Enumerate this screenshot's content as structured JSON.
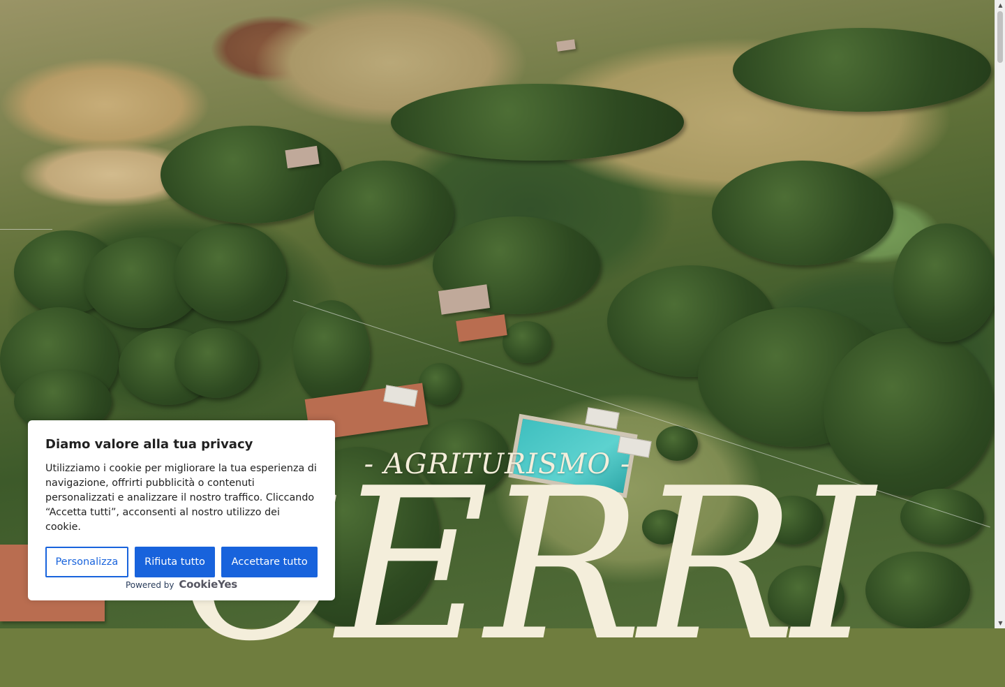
{
  "hero": {
    "kicker": "- AGRITURISMO -",
    "title": "CERRI"
  },
  "cookie_banner": {
    "title": "Diamo valore alla tua privacy",
    "body": "Utilizziamo i cookie per migliorare la tua esperienza di navigazione, offrirti pubblicità o contenuti personalizzati e analizzare il nostro traffico. Cliccando “Accetta tutti”, acconsenti al nostro utilizzo dei cookie.",
    "buttons": {
      "customize": "Personalizza",
      "reject": "Rifiuta tutto",
      "accept": "Accettare tutto"
    },
    "powered_by": "Powered by",
    "brand": "CookieYes"
  },
  "colors": {
    "accent": "#1863dc",
    "hero_text": "#f4eedb",
    "banner_bg": "#ffffff"
  },
  "icons": {
    "scroll_up": "triangle-up",
    "scroll_down": "triangle-down"
  }
}
